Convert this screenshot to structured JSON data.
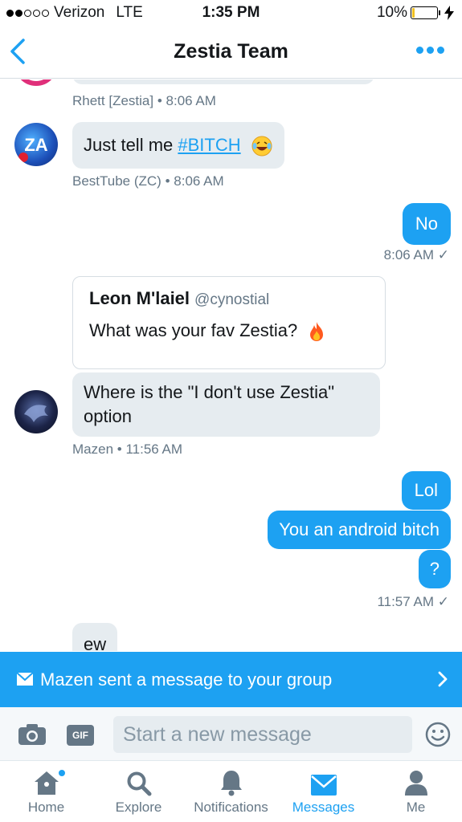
{
  "status_bar": {
    "carrier": "Verizon",
    "network": "LTE",
    "time": "1:35 PM",
    "battery": "10%",
    "battery_level": 0.1
  },
  "header": {
    "title": "Zestia Team",
    "back_icon": "chevron-left-icon",
    "more_icon": "more-dots-icon"
  },
  "messages": [
    {
      "sender": "Rhett [Zestia]",
      "time": "8:06 AM"
    },
    {
      "sender": "BestTube (ZC)",
      "time": "8:06 AM",
      "text_before": "Just tell me ",
      "hashtag": "#BITCH",
      "emoji": "laughing-crying-emoji"
    },
    {
      "text": "No",
      "time": "8:06 AM",
      "outgoing": true
    },
    {
      "quote": {
        "name": "Leon M'laiel",
        "handle": "@cynostial",
        "text": "What was your fav Zestia?",
        "emoji": "fire-emoji"
      }
    },
    {
      "sender": "Mazen",
      "time": "11:56 AM",
      "text": "Where is the \"I don't use Zestia\" option"
    },
    {
      "text": "Lol",
      "outgoing": true
    },
    {
      "text": "You an android bitch",
      "outgoing": true
    },
    {
      "text": "?",
      "outgoing": true,
      "time": "11:57 AM"
    },
    {
      "text": "ew"
    }
  ],
  "meta_sep": "•",
  "read_check": "✓",
  "banner": {
    "text": "Mazen sent a message to your group"
  },
  "composer": {
    "placeholder": "Start a new message",
    "gif_label": "GIF"
  },
  "tabs": [
    {
      "label": "Home",
      "icon": "home-icon",
      "active": false,
      "badge": true
    },
    {
      "label": "Explore",
      "icon": "search-icon",
      "active": false
    },
    {
      "label": "Notifications",
      "icon": "bell-icon",
      "active": false
    },
    {
      "label": "Messages",
      "icon": "envelope-icon",
      "active": true
    },
    {
      "label": "Me",
      "icon": "person-icon",
      "active": false
    }
  ],
  "colors": {
    "accent": "#1da1f2",
    "bubble_in": "#e6ecf0",
    "meta_gray": "#657786"
  }
}
